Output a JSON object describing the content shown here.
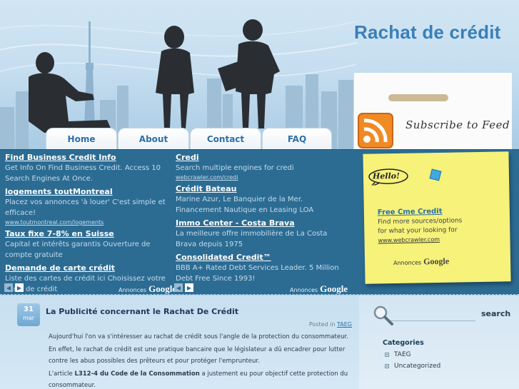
{
  "header": {
    "site_title": "Rachat de crédit",
    "subscribe_label": "Subscribe to Feed",
    "rss_icon": "rss-feed-icon"
  },
  "nav": {
    "tabs": [
      {
        "label": "Home"
      },
      {
        "label": "About"
      },
      {
        "label": "Contact"
      },
      {
        "label": "FAQ"
      }
    ]
  },
  "ads_left": [
    {
      "title": "Find Business Credit Info",
      "desc": "Get Info On Find Business Credit. Access 10 Search Engines At Once.",
      "url": ""
    },
    {
      "title": "logements toutMontreal",
      "desc": "Placez vos annonces 'à louer' C'est simple et efficace!",
      "url": "www.toutmontreal.com/logements"
    },
    {
      "title": "Taux fixe 7-8% en Suisse",
      "desc": "Capital et intérêts garantis Ouverture de compte gratuite",
      "url": ""
    },
    {
      "title": "Demande de carte crédit",
      "desc": "Liste des cartes de crédit ici Choisissez votre carte de crédit",
      "url": ""
    }
  ],
  "ads_right": [
    {
      "title": "Credi",
      "desc": "Search multiple engines for credi",
      "url": "webcrawler.com/credi"
    },
    {
      "title": "Crédit Bateau",
      "desc": "Marine Azur, Le Banquier de la Mer. Financement Nautique en Leasing LOA",
      "url": ""
    },
    {
      "title": "Immo Center - Costa Brava",
      "desc": "La meilleure offre immobilière de La Costa Brava depuis 1975",
      "url": ""
    },
    {
      "title": "Consolidated Credit™",
      "desc": "BBB A+ Rated Debt Services Leader. 5 Million Debt Free Since 1993!",
      "url": ""
    }
  ],
  "ads_by": {
    "prefix": "Annonces",
    "brand": "Google"
  },
  "sticky": {
    "hello": "Hello!",
    "ad_title": "Free Cme Credit",
    "ad_desc": "Find more sources/options for what your looking for",
    "ad_url": "www.webcrawler.com"
  },
  "post": {
    "day": "31",
    "month": "mar",
    "title": "La Publicité concernant le Rachat De Crédit",
    "posted_in_prefix": "Posted in",
    "category": "TAEG",
    "p1": "Aujourd'hui l'on va s'intéresser au rachat de crédit sous l'angle de la protection du consommateur.",
    "p2": "En effet, le rachat de crédit est une pratique bancaire que le législateur a dû encadrer pour lutter contre les abus possibles des prêteurs et pour protéger l'emprunteur.",
    "p3_prefix": "L'article",
    "p3_bold": "L312-4 du Code de la Consommation",
    "p3_suffix": "a justement eu pour objectif cette protection du consommateur."
  },
  "sidebar": {
    "search_placeholder": "",
    "search_button": "search",
    "categories_title": "Categories",
    "categories": [
      "TAEG",
      "Uncategorized"
    ]
  }
}
